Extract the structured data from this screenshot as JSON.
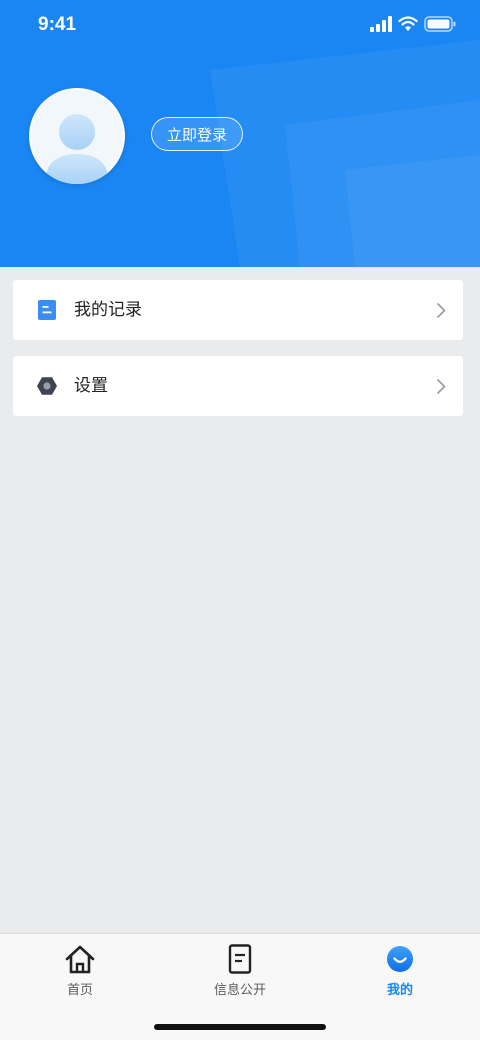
{
  "status_bar": {
    "time": "9:41"
  },
  "profile": {
    "login_button_label": "立即登录",
    "avatar_icon": "default-user-avatar"
  },
  "menu": {
    "items": [
      {
        "label": "我的记录",
        "icon": "records-icon"
      },
      {
        "label": "设置",
        "icon": "settings-icon"
      }
    ]
  },
  "tabbar": {
    "tabs": [
      {
        "label": "首页",
        "icon": "home-icon",
        "active": false
      },
      {
        "label": "信息公开",
        "icon": "document-icon",
        "active": false
      },
      {
        "label": "我的",
        "icon": "profile-icon",
        "active": true
      }
    ]
  },
  "colors": {
    "primary": "#1a86f4",
    "background": "#eaebed",
    "card": "#ffffff",
    "text": "#222222",
    "tab_inactive": "#5b5b5b"
  }
}
